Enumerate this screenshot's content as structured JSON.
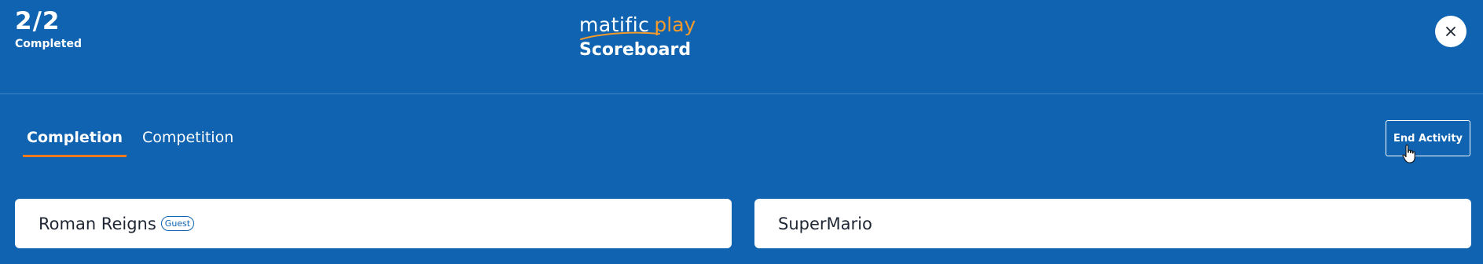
{
  "header": {
    "progress": {
      "count": "2/2",
      "label": "Completed"
    },
    "logo": {
      "brand": "matific",
      "product": "play"
    },
    "title": "Scoreboard",
    "close_icon": "close-icon"
  },
  "tabs": [
    {
      "label": "Completion",
      "active": true
    },
    {
      "label": "Competition",
      "active": false
    }
  ],
  "actions": {
    "end_activity_label": "End Activity"
  },
  "players": [
    {
      "name": "Roman Reigns",
      "badge": "Guest"
    },
    {
      "name": "SuperMario"
    }
  ],
  "colors": {
    "background": "#0F63B0",
    "accent": "#F47A1F",
    "logo_play": "#F49A2C",
    "card": "#FFFFFF",
    "text_dark": "#1F2633"
  }
}
